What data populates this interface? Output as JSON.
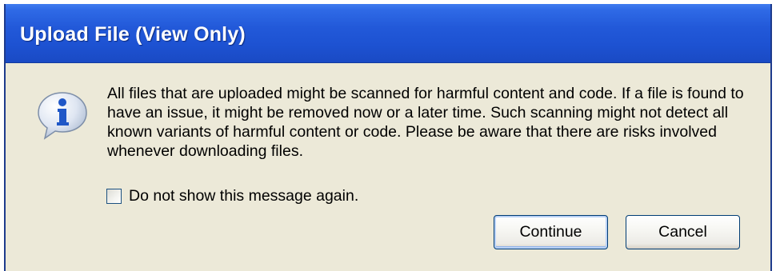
{
  "dialog": {
    "title": "Upload File (View Only)",
    "icon": "info-icon",
    "message": "All files that are uploaded might be scanned for harmful content and code.  If a file is found to have an issue, it might be removed now or a later time. Such scanning might not detect all known variants of harmful content or code. Please be aware that there are risks involved whenever downloading files.",
    "checkbox": {
      "label": "Do not show this message again.",
      "checked": false
    },
    "buttons": {
      "continue_label": "Continue",
      "cancel_label": "Cancel"
    }
  },
  "colors": {
    "titlebar": "#2259d9",
    "dialog_bg": "#ece9d8",
    "title_text": "#ffffff",
    "button_border": "#003c74"
  }
}
